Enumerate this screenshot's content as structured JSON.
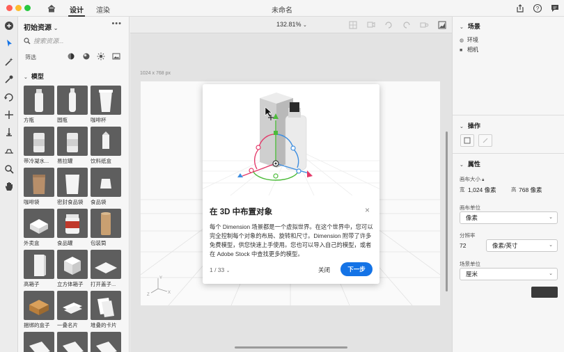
{
  "titlebar": {
    "tabs": [
      "设计",
      "渲染"
    ],
    "doc_title": "未命名"
  },
  "assets": {
    "header": "初始资源",
    "search_placeholder": "搜索资源...",
    "filter_label": "筛选",
    "section": "模型",
    "items": [
      {
        "label": "方瓶",
        "shape": "bottle"
      },
      {
        "label": "圆瓶",
        "shape": "bottle2"
      },
      {
        "label": "咖啡杯",
        "shape": "cup"
      },
      {
        "label": "带冷凝水...",
        "shape": "can"
      },
      {
        "label": "易拉罐",
        "shape": "can"
      },
      {
        "label": "饮料纸盒",
        "shape": "carton"
      },
      {
        "label": "咖啡袋",
        "shape": "bag"
      },
      {
        "label": "密封食品袋",
        "shape": "pouch"
      },
      {
        "label": "食品袋",
        "shape": "pack"
      },
      {
        "label": "外卖盒",
        "shape": "box"
      },
      {
        "label": "食品罐",
        "shape": "jar"
      },
      {
        "label": "包装筒",
        "shape": "tube"
      },
      {
        "label": "高箱子",
        "shape": "tall"
      },
      {
        "label": "立方体箱子",
        "shape": "cube"
      },
      {
        "label": "打开盖子...",
        "shape": "flat"
      },
      {
        "label": "捆绑的盒子",
        "shape": "brown"
      },
      {
        "label": "一叠名片",
        "shape": "cards"
      },
      {
        "label": "堆叠的卡片",
        "shape": "cards2"
      },
      {
        "label": "",
        "shape": "paper"
      },
      {
        "label": "",
        "shape": "paper"
      },
      {
        "label": "",
        "shape": "paper"
      }
    ]
  },
  "canvas": {
    "zoom": "132.81%",
    "size_label": "1024 x 768 px"
  },
  "dialog": {
    "title": "在 3D 中布置对象",
    "close": "×",
    "body": "每个 Dimension 场景都是一个虚拟世界。在这个世界中，您可以完全控制每个对象的布局、旋转和尺寸。Dimension 附带了许多免费模型，供您快速上手使用。您也可以导入自己的模型，或者在 Adobe Stock 中查找更多的模型。",
    "pager": "1 / 33",
    "close_label": "关闭",
    "next_label": "下一步"
  },
  "right_panel": {
    "scene_title": "场景",
    "scene_items": [
      "环境",
      "相机"
    ],
    "ops_title": "操作",
    "props_title": "属性",
    "canvas_size_label": "画布大小",
    "width_label": "宽",
    "width_value": "1,024 像素",
    "height_label": "高",
    "height_value": "768 像素",
    "canvas_unit_label": "画布单位",
    "canvas_unit_value": "像素",
    "resolution_label": "分辨率",
    "resolution_value": "72",
    "resolution_unit": "像素/英寸",
    "scene_unit_label": "场景单位",
    "scene_unit_value": "厘米"
  },
  "colors": {
    "accent": "#1473e6",
    "gizmo_red": "#e33a6a",
    "gizmo_green": "#4cbb3a",
    "gizmo_blue": "#3d8ee0"
  }
}
